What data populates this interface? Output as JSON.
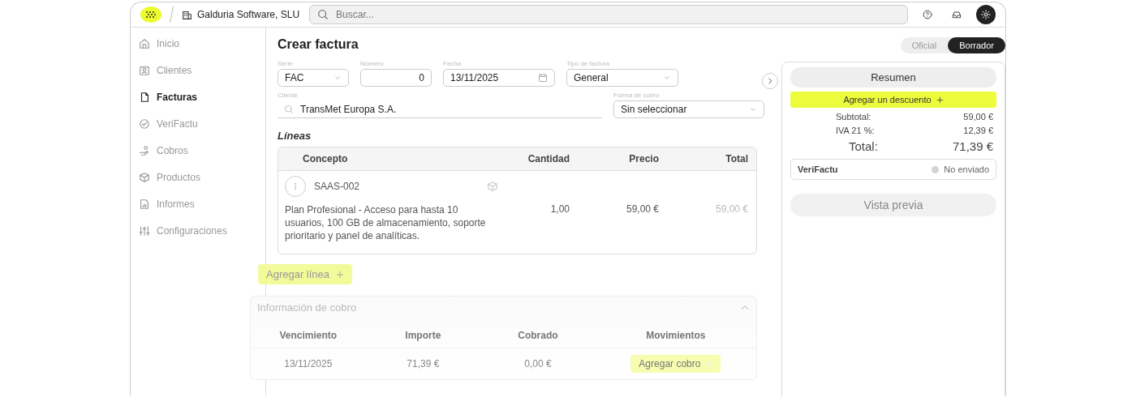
{
  "topbar": {
    "company": "Galduria Software, SLU",
    "search": {
      "placeholder": "Buscar..."
    }
  },
  "sidebar": {
    "items": [
      {
        "label": "Inicio",
        "selected": false
      },
      {
        "label": "Clientes",
        "selected": false
      },
      {
        "label": "Facturas",
        "selected": true
      },
      {
        "label": "VeriFactu",
        "selected": false
      },
      {
        "label": "Cobros",
        "selected": false
      },
      {
        "label": "Productos",
        "selected": false
      },
      {
        "label": "Informes",
        "selected": false
      },
      {
        "label": "Configuraciones",
        "selected": false
      }
    ]
  },
  "page": {
    "title": "Crear factura",
    "mode": [
      {
        "label": "Oficial",
        "selected": false
      },
      {
        "label": "Borrador",
        "selected": true
      }
    ]
  },
  "form": {
    "row_1": [
      {
        "label": "Serie",
        "value": "FAC",
        "kind": "select"
      },
      {
        "label": "Número",
        "value": "0",
        "kind": "number"
      },
      {
        "label": "Fecha",
        "value": "13/11/2025",
        "kind": "date"
      },
      {
        "label": "Tipo de factura",
        "value": "General",
        "kind": "select"
      }
    ],
    "row_2": [
      {
        "label": "Cliente",
        "value": "TransMet Europa S.A.",
        "kind": "search"
      },
      {
        "label": "Forma de cobro",
        "value": "Sin seleccionar",
        "kind": "select"
      }
    ]
  },
  "lines": {
    "heading": "Líneas",
    "columns": [
      "Concepto",
      "Cantidad",
      "Precio",
      "Total"
    ],
    "rows": [
      {
        "code": "SAAS-002",
        "description": "Plan Profesional - Acceso para hasta 10 usuarios, 100 GB de almacenamiento, soporte prioritario y panel de analíticas.",
        "quantity": "1,00",
        "price": "59,00 €",
        "total": "59,00 €"
      }
    ],
    "add_button": "Agregar línea"
  },
  "payment": {
    "title": "Información de cobro",
    "expanded": true,
    "columns": [
      "Vencimiento",
      "Importe",
      "Cobrado",
      "Movimientos"
    ],
    "rows": [
      {
        "due": "13/11/2025",
        "amount": "71,39 €",
        "paid": "0,00 €",
        "action": "Agregar cobro"
      }
    ]
  },
  "summary": {
    "title": "Resumen",
    "discount_button": "Agregar un descuento",
    "rows": [
      {
        "label": "Subtotal:",
        "value": "59,00 €"
      },
      {
        "label": "IVA 21 %:",
        "value": "12,39 €"
      }
    ],
    "total": {
      "label": "Total:",
      "value": "71,39 €"
    },
    "verifactu": {
      "label": "VeriFactu",
      "status": "No enviado",
      "color": "#d4d4d4"
    },
    "preview_button": "Vista previa"
  }
}
